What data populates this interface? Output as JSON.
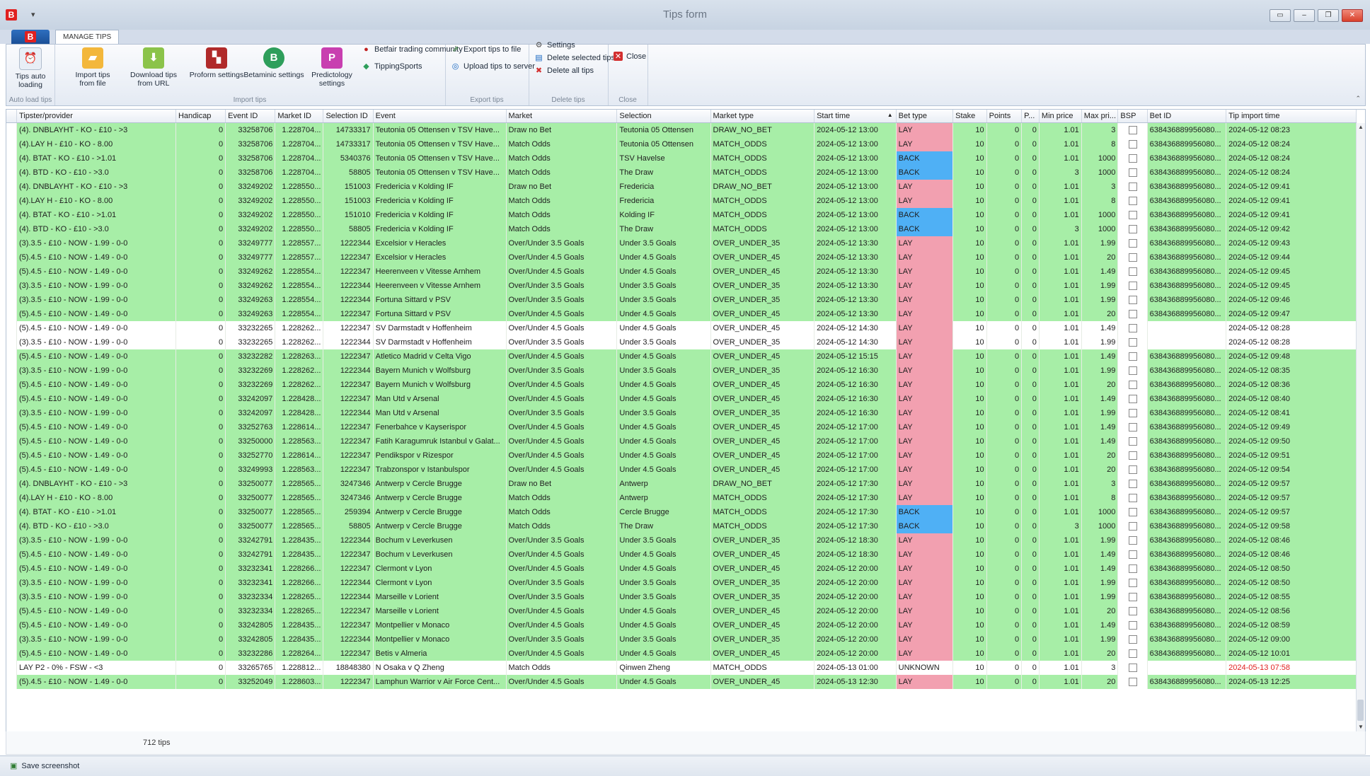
{
  "window": {
    "title": "Tips form",
    "qa_glyph": "▾"
  },
  "ribbon_tab": "MANAGE TIPS",
  "ribbon": {
    "tips_auto_loading": "Tips auto loading",
    "auto_load_group": "Auto load tips",
    "import_from_file": "Import tips from file",
    "download_from_url": "Download tips from URL",
    "proform_settings": "Proform settings",
    "betaminic_settings": "Betaminic settings",
    "predictology_settings": "Predictology settings",
    "betfair_trading_community": "Betfair trading community",
    "tipping_sports": "TippingSports",
    "import_group": "Import tips",
    "export_to_file": "Export tips to file",
    "upload_to_server": "Upload tips to server",
    "export_group": "Export tips",
    "settings": "Settings",
    "delete_selected": "Delete selected tips",
    "delete_all": "Delete all tips",
    "delete_group": "Delete tips",
    "close": "Close",
    "close_group": "Close"
  },
  "columns": [
    "Tipster/provider",
    "Handicap",
    "Event ID",
    "Market ID",
    "Selection ID",
    "Event",
    "Market",
    "Selection",
    "Market type",
    "Start time",
    "Bet type",
    "Stake",
    "Points",
    "P...",
    "Min price",
    "Max pri...",
    "BSP",
    "Bet ID",
    "Tip import time"
  ],
  "rows": [
    [
      "(4). DNBLAYHT - KO - £10 - >3",
      "0",
      "33258706",
      "1.228704...",
      "14733317",
      "Teutonia 05 Ottensen v TSV Have...",
      "Draw no Bet",
      "Teutonia 05 Ottensen",
      "DRAW_NO_BET",
      "2024-05-12 13:00",
      "LAY",
      "10",
      "0",
      "0",
      "1.01",
      "3",
      "",
      "638436889956080...",
      "2024-05-12 08:23"
    ],
    [
      "(4).LAY H - £10 - KO - 8.00",
      "0",
      "33258706",
      "1.228704...",
      "14733317",
      "Teutonia 05 Ottensen v TSV Have...",
      "Match Odds",
      "Teutonia 05 Ottensen",
      "MATCH_ODDS",
      "2024-05-12 13:00",
      "LAY",
      "10",
      "0",
      "0",
      "1.01",
      "8",
      "",
      "638436889956080...",
      "2024-05-12 08:24"
    ],
    [
      "(4). BTAT - KO - £10 - >1.01",
      "0",
      "33258706",
      "1.228704...",
      "5340376",
      "Teutonia 05 Ottensen v TSV Have...",
      "Match Odds",
      "TSV Havelse",
      "MATCH_ODDS",
      "2024-05-12 13:00",
      "BACK",
      "10",
      "0",
      "0",
      "1.01",
      "1000",
      "",
      "638436889956080...",
      "2024-05-12 08:24"
    ],
    [
      "(4). BTD - KO - £10 - >3.0",
      "0",
      "33258706",
      "1.228704...",
      "58805",
      "Teutonia 05 Ottensen v TSV Have...",
      "Match Odds",
      "The Draw",
      "MATCH_ODDS",
      "2024-05-12 13:00",
      "BACK",
      "10",
      "0",
      "0",
      "3",
      "1000",
      "",
      "638436889956080...",
      "2024-05-12 08:24"
    ],
    [
      "(4). DNBLAYHT - KO - £10 - >3",
      "0",
      "33249202",
      "1.228550...",
      "151003",
      "Fredericia v Kolding IF",
      "Draw no Bet",
      "Fredericia",
      "DRAW_NO_BET",
      "2024-05-12 13:00",
      "LAY",
      "10",
      "0",
      "0",
      "1.01",
      "3",
      "",
      "638436889956080...",
      "2024-05-12 09:41"
    ],
    [
      "(4).LAY H - £10 - KO - 8.00",
      "0",
      "33249202",
      "1.228550...",
      "151003",
      "Fredericia v Kolding IF",
      "Match Odds",
      "Fredericia",
      "MATCH_ODDS",
      "2024-05-12 13:00",
      "LAY",
      "10",
      "0",
      "0",
      "1.01",
      "8",
      "",
      "638436889956080...",
      "2024-05-12 09:41"
    ],
    [
      "(4). BTAT - KO - £10 - >1.01",
      "0",
      "33249202",
      "1.228550...",
      "151010",
      "Fredericia v Kolding IF",
      "Match Odds",
      "Kolding IF",
      "MATCH_ODDS",
      "2024-05-12 13:00",
      "BACK",
      "10",
      "0",
      "0",
      "1.01",
      "1000",
      "",
      "638436889956080...",
      "2024-05-12 09:41"
    ],
    [
      "(4). BTD - KO - £10 - >3.0",
      "0",
      "33249202",
      "1.228550...",
      "58805",
      "Fredericia v Kolding IF",
      "Match Odds",
      "The Draw",
      "MATCH_ODDS",
      "2024-05-12 13:00",
      "BACK",
      "10",
      "0",
      "0",
      "3",
      "1000",
      "",
      "638436889956080...",
      "2024-05-12 09:42"
    ],
    [
      "(3).3.5 - £10 - NOW - 1.99 - 0-0",
      "0",
      "33249777",
      "1.228557...",
      "1222344",
      "Excelsior v Heracles",
      "Over/Under 3.5 Goals",
      "Under 3.5 Goals",
      "OVER_UNDER_35",
      "2024-05-12 13:30",
      "LAY",
      "10",
      "0",
      "0",
      "1.01",
      "1.99",
      "",
      "638436889956080...",
      "2024-05-12 09:43"
    ],
    [
      "(5).4.5 - £10 - NOW - 1.49 - 0-0",
      "0",
      "33249777",
      "1.228557...",
      "1222347",
      "Excelsior v Heracles",
      "Over/Under 4.5 Goals",
      "Under 4.5 Goals",
      "OVER_UNDER_45",
      "2024-05-12 13:30",
      "LAY",
      "10",
      "0",
      "0",
      "1.01",
      "20",
      "",
      "638436889956080...",
      "2024-05-12 09:44"
    ],
    [
      "(5).4.5 - £10 - NOW - 1.49 - 0-0",
      "0",
      "33249262",
      "1.228554...",
      "1222347",
      "Heerenveen v Vitesse Arnhem",
      "Over/Under 4.5 Goals",
      "Under 4.5 Goals",
      "OVER_UNDER_45",
      "2024-05-12 13:30",
      "LAY",
      "10",
      "0",
      "0",
      "1.01",
      "1.49",
      "",
      "638436889956080...",
      "2024-05-12 09:45"
    ],
    [
      "(3).3.5 - £10 - NOW - 1.99 - 0-0",
      "0",
      "33249262",
      "1.228554...",
      "1222344",
      "Heerenveen v Vitesse Arnhem",
      "Over/Under 3.5 Goals",
      "Under 3.5 Goals",
      "OVER_UNDER_35",
      "2024-05-12 13:30",
      "LAY",
      "10",
      "0",
      "0",
      "1.01",
      "1.99",
      "",
      "638436889956080...",
      "2024-05-12 09:45"
    ],
    [
      "(3).3.5 - £10 - NOW - 1.99 - 0-0",
      "0",
      "33249263",
      "1.228554...",
      "1222344",
      "Fortuna Sittard v PSV",
      "Over/Under 3.5 Goals",
      "Under 3.5 Goals",
      "OVER_UNDER_35",
      "2024-05-12 13:30",
      "LAY",
      "10",
      "0",
      "0",
      "1.01",
      "1.99",
      "",
      "638436889956080...",
      "2024-05-12 09:46"
    ],
    [
      "(5).4.5 - £10 - NOW - 1.49 - 0-0",
      "0",
      "33249263",
      "1.228554...",
      "1222347",
      "Fortuna Sittard v PSV",
      "Over/Under 4.5 Goals",
      "Under 4.5 Goals",
      "OVER_UNDER_45",
      "2024-05-12 13:30",
      "LAY",
      "10",
      "0",
      "0",
      "1.01",
      "20",
      "",
      "638436889956080...",
      "2024-05-12 09:47"
    ],
    [
      "(5).4.5 - £10 - NOW - 1.49 - 0-0",
      "0",
      "33232265",
      "1.228262...",
      "1222347",
      "SV Darmstadt v Hoffenheim",
      "Over/Under 4.5 Goals",
      "Under 4.5 Goals",
      "OVER_UNDER_45",
      "2024-05-12 14:30",
      "LAY",
      "10",
      "0",
      "0",
      "1.01",
      "1.49",
      "",
      "",
      "2024-05-12 08:28"
    ],
    [
      "(3).3.5 - £10 - NOW - 1.99 - 0-0",
      "0",
      "33232265",
      "1.228262...",
      "1222344",
      "SV Darmstadt v Hoffenheim",
      "Over/Under 3.5 Goals",
      "Under 3.5 Goals",
      "OVER_UNDER_35",
      "2024-05-12 14:30",
      "LAY",
      "10",
      "0",
      "0",
      "1.01",
      "1.99",
      "",
      "",
      "2024-05-12 08:28"
    ],
    [
      "(5).4.5 - £10 - NOW - 1.49 - 0-0",
      "0",
      "33232282",
      "1.228263...",
      "1222347",
      "Atletico Madrid v Celta Vigo",
      "Over/Under 4.5 Goals",
      "Under 4.5 Goals",
      "OVER_UNDER_45",
      "2024-05-12 15:15",
      "LAY",
      "10",
      "0",
      "0",
      "1.01",
      "1.49",
      "",
      "638436889956080...",
      "2024-05-12 09:48"
    ],
    [
      "(3).3.5 - £10 - NOW - 1.99 - 0-0",
      "0",
      "33232269",
      "1.228262...",
      "1222344",
      "Bayern Munich v Wolfsburg",
      "Over/Under 3.5 Goals",
      "Under 3.5 Goals",
      "OVER_UNDER_35",
      "2024-05-12 16:30",
      "LAY",
      "10",
      "0",
      "0",
      "1.01",
      "1.99",
      "",
      "638436889956080...",
      "2024-05-12 08:35"
    ],
    [
      "(5).4.5 - £10 - NOW - 1.49 - 0-0",
      "0",
      "33232269",
      "1.228262...",
      "1222347",
      "Bayern Munich v Wolfsburg",
      "Over/Under 4.5 Goals",
      "Under 4.5 Goals",
      "OVER_UNDER_45",
      "2024-05-12 16:30",
      "LAY",
      "10",
      "0",
      "0",
      "1.01",
      "20",
      "",
      "638436889956080...",
      "2024-05-12 08:36"
    ],
    [
      "(5).4.5 - £10 - NOW - 1.49 - 0-0",
      "0",
      "33242097",
      "1.228428...",
      "1222347",
      "Man Utd v Arsenal",
      "Over/Under 4.5 Goals",
      "Under 4.5 Goals",
      "OVER_UNDER_45",
      "2024-05-12 16:30",
      "LAY",
      "10",
      "0",
      "0",
      "1.01",
      "1.49",
      "",
      "638436889956080...",
      "2024-05-12 08:40"
    ],
    [
      "(3).3.5 - £10 - NOW - 1.99 - 0-0",
      "0",
      "33242097",
      "1.228428...",
      "1222344",
      "Man Utd v Arsenal",
      "Over/Under 3.5 Goals",
      "Under 3.5 Goals",
      "OVER_UNDER_35",
      "2024-05-12 16:30",
      "LAY",
      "10",
      "0",
      "0",
      "1.01",
      "1.99",
      "",
      "638436889956080...",
      "2024-05-12 08:41"
    ],
    [
      "(5).4.5 - £10 - NOW - 1.49 - 0-0",
      "0",
      "33252763",
      "1.228614...",
      "1222347",
      "Fenerbahce v Kayserispor",
      "Over/Under 4.5 Goals",
      "Under 4.5 Goals",
      "OVER_UNDER_45",
      "2024-05-12 17:00",
      "LAY",
      "10",
      "0",
      "0",
      "1.01",
      "1.49",
      "",
      "638436889956080...",
      "2024-05-12 09:49"
    ],
    [
      "(5).4.5 - £10 - NOW - 1.49 - 0-0",
      "0",
      "33250000",
      "1.228563...",
      "1222347",
      "Fatih Karagumruk Istanbul v Galat...",
      "Over/Under 4.5 Goals",
      "Under 4.5 Goals",
      "OVER_UNDER_45",
      "2024-05-12 17:00",
      "LAY",
      "10",
      "0",
      "0",
      "1.01",
      "1.49",
      "",
      "638436889956080...",
      "2024-05-12 09:50"
    ],
    [
      "(5).4.5 - £10 - NOW - 1.49 - 0-0",
      "0",
      "33252770",
      "1.228614...",
      "1222347",
      "Pendikspor v Rizespor",
      "Over/Under 4.5 Goals",
      "Under 4.5 Goals",
      "OVER_UNDER_45",
      "2024-05-12 17:00",
      "LAY",
      "10",
      "0",
      "0",
      "1.01",
      "20",
      "",
      "638436889956080...",
      "2024-05-12 09:51"
    ],
    [
      "(5).4.5 - £10 - NOW - 1.49 - 0-0",
      "0",
      "33249993",
      "1.228563...",
      "1222347",
      "Trabzonspor v Istanbulspor",
      "Over/Under 4.5 Goals",
      "Under 4.5 Goals",
      "OVER_UNDER_45",
      "2024-05-12 17:00",
      "LAY",
      "10",
      "0",
      "0",
      "1.01",
      "20",
      "",
      "638436889956080...",
      "2024-05-12 09:54"
    ],
    [
      "(4). DNBLAYHT - KO - £10 - >3",
      "0",
      "33250077",
      "1.228565...",
      "3247346",
      "Antwerp v Cercle Brugge",
      "Draw no Bet",
      "Antwerp",
      "DRAW_NO_BET",
      "2024-05-12 17:30",
      "LAY",
      "10",
      "0",
      "0",
      "1.01",
      "3",
      "",
      "638436889956080...",
      "2024-05-12 09:57"
    ],
    [
      "(4).LAY H - £10 - KO - 8.00",
      "0",
      "33250077",
      "1.228565...",
      "3247346",
      "Antwerp v Cercle Brugge",
      "Match Odds",
      "Antwerp",
      "MATCH_ODDS",
      "2024-05-12 17:30",
      "LAY",
      "10",
      "0",
      "0",
      "1.01",
      "8",
      "",
      "638436889956080...",
      "2024-05-12 09:57"
    ],
    [
      "(4). BTAT - KO - £10 - >1.01",
      "0",
      "33250077",
      "1.228565...",
      "259394",
      "Antwerp v Cercle Brugge",
      "Match Odds",
      "Cercle Brugge",
      "MATCH_ODDS",
      "2024-05-12 17:30",
      "BACK",
      "10",
      "0",
      "0",
      "1.01",
      "1000",
      "",
      "638436889956080...",
      "2024-05-12 09:57"
    ],
    [
      "(4). BTD - KO - £10 - >3.0",
      "0",
      "33250077",
      "1.228565...",
      "58805",
      "Antwerp v Cercle Brugge",
      "Match Odds",
      "The Draw",
      "MATCH_ODDS",
      "2024-05-12 17:30",
      "BACK",
      "10",
      "0",
      "0",
      "3",
      "1000",
      "",
      "638436889956080...",
      "2024-05-12 09:58"
    ],
    [
      "(3).3.5 - £10 - NOW - 1.99 - 0-0",
      "0",
      "33242791",
      "1.228435...",
      "1222344",
      "Bochum v Leverkusen",
      "Over/Under 3.5 Goals",
      "Under 3.5 Goals",
      "OVER_UNDER_35",
      "2024-05-12 18:30",
      "LAY",
      "10",
      "0",
      "0",
      "1.01",
      "1.99",
      "",
      "638436889956080...",
      "2024-05-12 08:46"
    ],
    [
      "(5).4.5 - £10 - NOW - 1.49 - 0-0",
      "0",
      "33242791",
      "1.228435...",
      "1222347",
      "Bochum v Leverkusen",
      "Over/Under 4.5 Goals",
      "Under 4.5 Goals",
      "OVER_UNDER_45",
      "2024-05-12 18:30",
      "LAY",
      "10",
      "0",
      "0",
      "1.01",
      "1.49",
      "",
      "638436889956080...",
      "2024-05-12 08:46"
    ],
    [
      "(5).4.5 - £10 - NOW - 1.49 - 0-0",
      "0",
      "33232341",
      "1.228266...",
      "1222347",
      "Clermont v Lyon",
      "Over/Under 4.5 Goals",
      "Under 4.5 Goals",
      "OVER_UNDER_45",
      "2024-05-12 20:00",
      "LAY",
      "10",
      "0",
      "0",
      "1.01",
      "1.49",
      "",
      "638436889956080...",
      "2024-05-12 08:50"
    ],
    [
      "(3).3.5 - £10 - NOW - 1.99 - 0-0",
      "0",
      "33232341",
      "1.228266...",
      "1222344",
      "Clermont v Lyon",
      "Over/Under 3.5 Goals",
      "Under 3.5 Goals",
      "OVER_UNDER_35",
      "2024-05-12 20:00",
      "LAY",
      "10",
      "0",
      "0",
      "1.01",
      "1.99",
      "",
      "638436889956080...",
      "2024-05-12 08:50"
    ],
    [
      "(3).3.5 - £10 - NOW - 1.99 - 0-0",
      "0",
      "33232334",
      "1.228265...",
      "1222344",
      "Marseille v Lorient",
      "Over/Under 3.5 Goals",
      "Under 3.5 Goals",
      "OVER_UNDER_35",
      "2024-05-12 20:00",
      "LAY",
      "10",
      "0",
      "0",
      "1.01",
      "1.99",
      "",
      "638436889956080...",
      "2024-05-12 08:55"
    ],
    [
      "(5).4.5 - £10 - NOW - 1.49 - 0-0",
      "0",
      "33232334",
      "1.228265...",
      "1222347",
      "Marseille v Lorient",
      "Over/Under 4.5 Goals",
      "Under 4.5 Goals",
      "OVER_UNDER_45",
      "2024-05-12 20:00",
      "LAY",
      "10",
      "0",
      "0",
      "1.01",
      "20",
      "",
      "638436889956080...",
      "2024-05-12 08:56"
    ],
    [
      "(5).4.5 - £10 - NOW - 1.49 - 0-0",
      "0",
      "33242805",
      "1.228435...",
      "1222347",
      "Montpellier v Monaco",
      "Over/Under 4.5 Goals",
      "Under 4.5 Goals",
      "OVER_UNDER_45",
      "2024-05-12 20:00",
      "LAY",
      "10",
      "0",
      "0",
      "1.01",
      "1.49",
      "",
      "638436889956080...",
      "2024-05-12 08:59"
    ],
    [
      "(3).3.5 - £10 - NOW - 1.99 - 0-0",
      "0",
      "33242805",
      "1.228435...",
      "1222344",
      "Montpellier v Monaco",
      "Over/Under 3.5 Goals",
      "Under 3.5 Goals",
      "OVER_UNDER_35",
      "2024-05-12 20:00",
      "LAY",
      "10",
      "0",
      "0",
      "1.01",
      "1.99",
      "",
      "638436889956080...",
      "2024-05-12 09:00"
    ],
    [
      "(5).4.5 - £10 - NOW - 1.49 - 0-0",
      "0",
      "33232286",
      "1.228264...",
      "1222347",
      "Betis v Almeria",
      "Over/Under 4.5 Goals",
      "Under 4.5 Goals",
      "OVER_UNDER_45",
      "2024-05-12 20:00",
      "LAY",
      "10",
      "0",
      "0",
      "1.01",
      "20",
      "",
      "638436889956080...",
      "2024-05-12 10:01"
    ],
    [
      "LAY P2 - 0% - FSW - <3",
      "0",
      "33265765",
      "1.228812...",
      "18848380",
      "N Osaka v Q Zheng",
      "Match Odds",
      "Qinwen Zheng",
      "MATCH_ODDS",
      "2024-05-13 01:00",
      "UNKNOWN",
      "10",
      "0",
      "0",
      "1.01",
      "3",
      "",
      "",
      "2024-05-13 07:58"
    ],
    [
      "(5).4.5 - £10 - NOW - 1.49 - 0-0",
      "0",
      "33252049",
      "1.228603...",
      "1222347",
      "Lamphun Warrior v Air Force Cent...",
      "Over/Under 4.5 Goals",
      "Under 4.5 Goals",
      "OVER_UNDER_45",
      "2024-05-13 12:30",
      "LAY",
      "10",
      "0",
      "0",
      "1.01",
      "20",
      "",
      "638436889956080...",
      "2024-05-13 12:25"
    ]
  ],
  "sort_indicator": "▲",
  "footer": {
    "count": "712 tips"
  },
  "status": {
    "save_screenshot": "Save screenshot"
  },
  "colors": {
    "row_green": "#a7eea7",
    "lay": "#f2a0b0",
    "back": "#4fb0f5"
  }
}
